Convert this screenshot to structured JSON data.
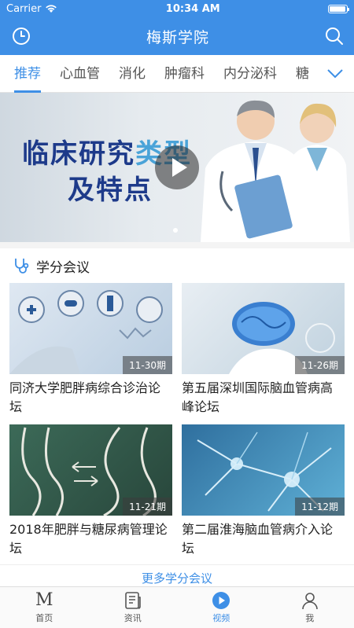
{
  "status": {
    "carrier": "Carrier",
    "time": "10:34 AM",
    "battery_level": 0.95
  },
  "header": {
    "title": "梅斯学院",
    "history_icon": "clock-icon",
    "search_icon": "search-icon"
  },
  "tabs": [
    {
      "label": "推荐",
      "active": true
    },
    {
      "label": "心血管",
      "active": false
    },
    {
      "label": "消化",
      "active": false
    },
    {
      "label": "肿瘤科",
      "active": false
    },
    {
      "label": "内分泌科",
      "active": false
    },
    {
      "label": "糖",
      "active": false
    }
  ],
  "banner": {
    "line1a": "临床研究",
    "line1b": "类型",
    "line2": "及特点",
    "play_icon": "play-icon"
  },
  "section": {
    "title": "学分会议",
    "icon": "stethoscope-icon",
    "cards": [
      {
        "badge": "11-30期",
        "title": "同济大学肥胖病综合诊治论坛"
      },
      {
        "badge": "11-26期",
        "title": "第五届深圳国际脑血管病高峰论坛"
      },
      {
        "badge": "11-21期",
        "title": "2018年肥胖与糖尿病管理论坛"
      },
      {
        "badge": "11-12期",
        "title": "第二届淮海脑血管病介入论坛"
      }
    ],
    "more": "更多学分会议"
  },
  "bottom_nav": [
    {
      "label": "首页",
      "icon": "home-m-icon",
      "active": false
    },
    {
      "label": "资讯",
      "icon": "news-icon",
      "active": false
    },
    {
      "label": "视频",
      "icon": "video-play-icon",
      "active": true
    },
    {
      "label": "我",
      "icon": "person-icon",
      "active": false
    }
  ],
  "colors": {
    "brand": "#3e8fe6"
  }
}
